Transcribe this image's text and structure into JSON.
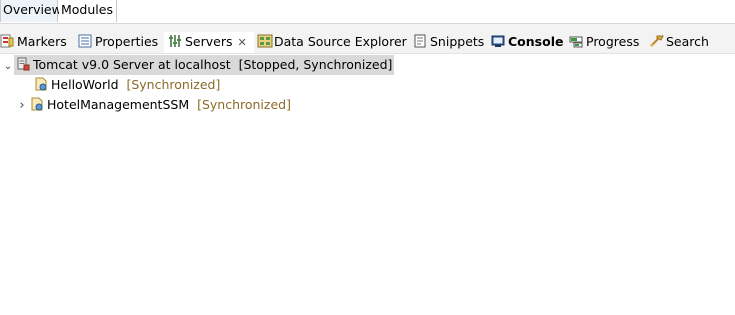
{
  "editor_tabs": [
    "Overview",
    "Modules"
  ],
  "views": {
    "markers": "Markers",
    "properties": "Properties",
    "servers": "Servers",
    "servers_close": "✕",
    "data_source_explorer": "Data Source Explorer",
    "snippets": "Snippets",
    "console": "Console",
    "progress": "Progress",
    "search": "Search"
  },
  "tree": {
    "server": {
      "expander": "⌄",
      "name": "Tomcat v9.0 Server at localhost",
      "status": "[Stopped, Synchronized]"
    },
    "modules": [
      {
        "name": "HelloWorld",
        "status": "[Synchronized]",
        "expander": ""
      },
      {
        "name": "HotelManagementSSM",
        "status": "[Synchronized]",
        "expander": "›"
      }
    ]
  },
  "colors": {
    "sync_text": "#8b6a2a",
    "selection": "#d9d9d9",
    "toolbar_bg": "#f3f3f3"
  }
}
